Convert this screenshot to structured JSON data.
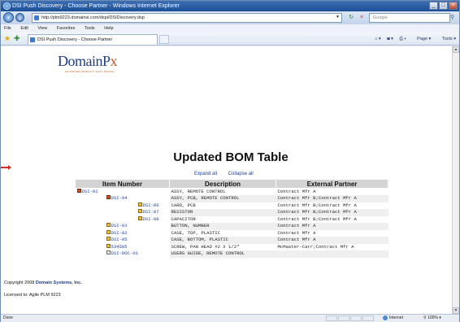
{
  "window": {
    "title": "DSI Push Discovery - Choose Partner - Windows Internet Explorer"
  },
  "nav": {
    "url": "http://plm9223.domainsi.com/dspi/DSIDiscovery.dsp",
    "search_placeholder": "Google"
  },
  "menu": [
    "File",
    "Edit",
    "View",
    "Favorites",
    "Tools",
    "Help"
  ],
  "favorites": {
    "tab_label": "DSI Push Discovery - Choose Partner",
    "commands": [
      "Page",
      "Tools"
    ]
  },
  "logo": {
    "text_main": "DomainP",
    "text_accent": "x",
    "tagline": "ADVANCED PRODUCT DATA PORTAL"
  },
  "page": {
    "title": "Updated BOM Table",
    "expand_all": "Expand all",
    "collapse_all": "Collapse all"
  },
  "table": {
    "headers": [
      "Item Number",
      "Description",
      "External Partner"
    ],
    "rows": [
      {
        "item": "DSI-01",
        "desc": "ASSY, REMOTE CONTROL",
        "partner": "Contract Mfr A"
      },
      {
        "item": "DSI-04",
        "desc": "ASSY, PCB, REMOTE CONTROL",
        "partner": "Contract Mfr B;Contract Mfr A"
      },
      {
        "item": "DSI-06",
        "desc": "CARD, PCB",
        "partner": "Contract Mfr B;Contract Mfr A"
      },
      {
        "item": "DSI-07",
        "desc": "RESISTOR",
        "partner": "Contract Mfr B;Contract Mfr A"
      },
      {
        "item": "DSI-08",
        "desc": "CAPACITOR",
        "partner": "Contract Mfr B;Contract Mfr A"
      },
      {
        "item": "DSI-03",
        "desc": "BUTTON, NUMBER",
        "partner": "Contract Mfr A"
      },
      {
        "item": "DSI-02",
        "desc": "CASE, TOP, PLASTIC",
        "partner": "Contract Mfr A"
      },
      {
        "item": "DSI-05",
        "desc": "CASE, BOTTOM, PLASTIC",
        "partner": "Contract Mfr A"
      },
      {
        "item": "534505",
        "desc": "SCREW, PAN HEAD #2 X 1/2\"",
        "partner": "McMaster-Carr;Contract Mfr A"
      },
      {
        "item": "DSI-DOC-01",
        "desc": "USERS GUIDE, REMOTE CONTROL",
        "partner": ""
      }
    ]
  },
  "footer": {
    "copyright_prefix": "Copyright 2008 ",
    "company": "Domain Systems, Inc.",
    "licensed": "Licensed to: Agile PLM 9223"
  },
  "status": {
    "left": "Done",
    "zone": "Internet",
    "zoom": "100%"
  },
  "colors": {
    "link": "#1c3fa0",
    "logo_blue": "#1f3f86",
    "logo_accent": "#c4561f",
    "header_gray": "#d3d3d3"
  }
}
